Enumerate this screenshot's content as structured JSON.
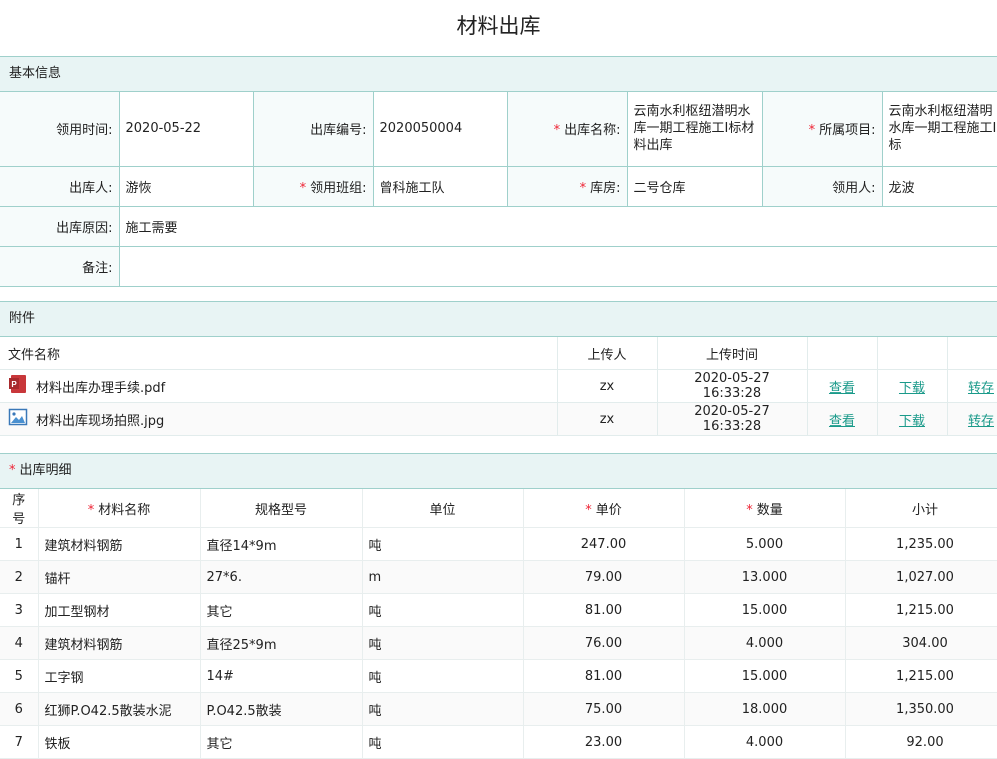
{
  "page_title": "材料出库",
  "sections": {
    "basic": "基本信息",
    "attachments": "附件",
    "details": "出库明细"
  },
  "basic": {
    "time_label": "领用时间:",
    "time": "2020-05-22",
    "code_label": "出库编号:",
    "code": "2020050004",
    "name_label": "出库名称:",
    "name": "云南水利枢纽潜明水库一期工程施工I标材料出库",
    "project_label": "所属项目:",
    "project": "云南水利枢纽潜明水库一期工程施工I标",
    "outby_label": "出库人:",
    "outby": "游恢",
    "team_label": "领用班组:",
    "team": "曾科施工队",
    "store_label": "库房:",
    "store": "二号仓库",
    "receiver_label": "领用人:",
    "receiver": "龙波",
    "reason_label": "出库原因:",
    "reason": "施工需要",
    "remark_label": "备注:",
    "remark": ""
  },
  "attachments": {
    "headers": {
      "file": "文件名称",
      "uploader": "上传人",
      "time": "上传时间"
    },
    "actions": {
      "view": "查看",
      "download": "下载",
      "transfer": "转存"
    },
    "rows": [
      {
        "icon": "pdf-file-icon",
        "name": "材料出库办理手续.pdf",
        "uploader": "zx",
        "time": "2020-05-27 16:33:28"
      },
      {
        "icon": "image-file-icon",
        "name": "材料出库现场拍照.jpg",
        "uploader": "zx",
        "time": "2020-05-27 16:33:28"
      }
    ]
  },
  "details": {
    "headers": {
      "no": "序号",
      "material": "材料名称",
      "spec": "规格型号",
      "unit": "单位",
      "price": "单价",
      "qty": "数量",
      "subtotal": "小计"
    },
    "rows": [
      {
        "no": "1",
        "material": "建筑材料钢筋",
        "spec": "直径14*9m",
        "unit": "吨",
        "price": "247.00",
        "qty": "5.000",
        "subtotal": "1,235.00"
      },
      {
        "no": "2",
        "material": "锚杆",
        "spec": "27*6.",
        "unit": "m",
        "price": "79.00",
        "qty": "13.000",
        "subtotal": "1,027.00"
      },
      {
        "no": "3",
        "material": "加工型钢材",
        "spec": "其它",
        "unit": "吨",
        "price": "81.00",
        "qty": "15.000",
        "subtotal": "1,215.00"
      },
      {
        "no": "4",
        "material": "建筑材料钢筋",
        "spec": "直径25*9m",
        "unit": "吨",
        "price": "76.00",
        "qty": "4.000",
        "subtotal": "304.00"
      },
      {
        "no": "5",
        "material": "工字钢",
        "spec": "14#",
        "unit": "吨",
        "price": "81.00",
        "qty": "15.000",
        "subtotal": "1,215.00"
      },
      {
        "no": "6",
        "material": "红狮P.O42.5散装水泥",
        "spec": "P.O42.5散装",
        "unit": "吨",
        "price": "75.00",
        "qty": "18.000",
        "subtotal": "1,350.00"
      },
      {
        "no": "7",
        "material": "铁板",
        "spec": "其它",
        "unit": "吨",
        "price": "23.00",
        "qty": "4.000",
        "subtotal": "92.00"
      }
    ]
  }
}
